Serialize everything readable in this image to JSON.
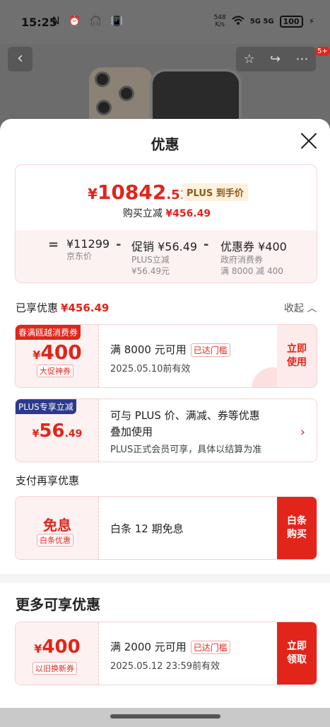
{
  "status_bar": {
    "time": "15:25",
    "left_icons": "N ⏰ 🎧 📳",
    "net_speed_top": "548",
    "net_speed_bottom": "K/s",
    "signal": "5G 5G",
    "battery": "100"
  },
  "sheet": {
    "title": "优惠"
  },
  "price_card": {
    "yen": "¥",
    "price_int": "10842",
    "price_dec": ".51",
    "plus_tag": "PLUS 到手价",
    "buy_save_label": "购买立减",
    "buy_save_amount": "¥456.49",
    "base_price": "¥11299",
    "base_label": "京东价",
    "minus1": "-",
    "promo_price": "促销 ¥56.49",
    "promo_sub1": "PLUS立减",
    "promo_sub2": "¥56.49元",
    "minus2": "-",
    "coupon_price": "优惠券 ¥400",
    "coupon_sub1": "政府消费券",
    "coupon_sub2": "满 8000 减 400",
    "equals": "="
  },
  "enjoyed": {
    "label": "已享优惠",
    "amount": "¥456.49",
    "collapse": "收起 ︿"
  },
  "coupons": [
    {
      "tag": "春满瓯越消费券",
      "yen": "¥",
      "amount": "400",
      "sub": "大促神券",
      "line1": "满 8000 元可用",
      "reached": "已达门槛",
      "line2": "2025.05.10前有效",
      "btn": "立即使用"
    },
    {
      "tag": "PLUS专享立减",
      "yen": "¥",
      "amount": "56",
      "dec": ".49",
      "line1": "可与 PLUS 价、满减、券等优惠",
      "line1b": "叠加使用",
      "line2": "PLUS正式会员可享，具体以结算为准",
      "arrow": "›"
    }
  ],
  "pay_section": {
    "label": "支付再享优惠",
    "left_title": "免息",
    "left_sub": "白条优惠",
    "middle": "白条 12 期免息",
    "btn": "白条购买"
  },
  "more": {
    "title": "更多可享优惠",
    "coupon": {
      "yen": "¥",
      "amount": "400",
      "sub": "以旧换新券",
      "line1": "满 2000 元可用",
      "reached": "已达门槛",
      "line2": "2025.05.12 23:59前有效",
      "btn": "立即领取"
    }
  }
}
